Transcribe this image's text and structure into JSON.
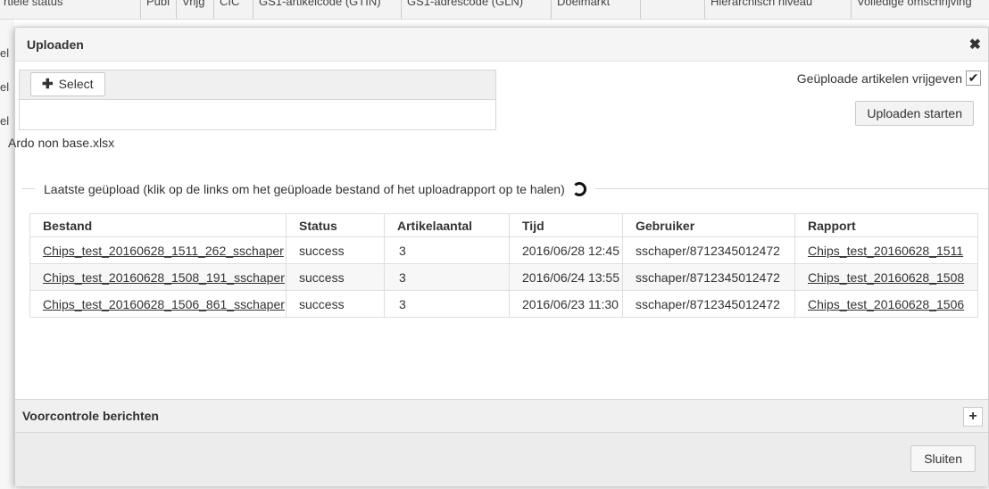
{
  "background": {
    "columns": [
      "rtiele status",
      "Publ",
      "Vrijg",
      "CIC",
      "GS1-artikelcode (GTIN)",
      "GS1-adrescode (GLN)",
      "Doelmarkt",
      "",
      "Hiërarchisch niveau",
      "Volledige omschrijving"
    ],
    "left_fragments": [
      "el",
      "el",
      "el"
    ]
  },
  "dialog": {
    "title": "Uploaden",
    "close_icon": "close-icon",
    "select_label": "Select",
    "selected_file": "Ardo non base.xlsx",
    "release_label": "Geüploade artikelen vrijgeven",
    "release_checked": "✔",
    "start_label": "Uploaden starten",
    "legend": "Laatste geüpload (klik op de links om het geüploade bestand of het uploadrapport op te halen)",
    "table": {
      "headers": [
        "Bestand",
        "Status",
        "Artikelaantal",
        "Tijd",
        "Gebruiker",
        "Rapport"
      ],
      "rows": [
        [
          "Chips_test_20160628_1511_262_sschaper",
          "success",
          "3",
          "2016/06/28 12:45",
          "sschaper/8712345012472",
          "Chips_test_20160628_1511"
        ],
        [
          "Chips_test_20160628_1508_191_sschaper",
          "success",
          "3",
          "2016/06/24 13:55",
          "sschaper/8712345012472",
          "Chips_test_20160628_1508"
        ],
        [
          "Chips_test_20160628_1506_861_sschaper",
          "success",
          "3",
          "2016/06/23 11:30",
          "sschaper/8712345012472",
          "Chips_test_20160628_1506"
        ]
      ]
    },
    "precheck_title": "Voorcontrole berichten",
    "precheck_toggle": "+",
    "close_label": "Sluiten"
  }
}
